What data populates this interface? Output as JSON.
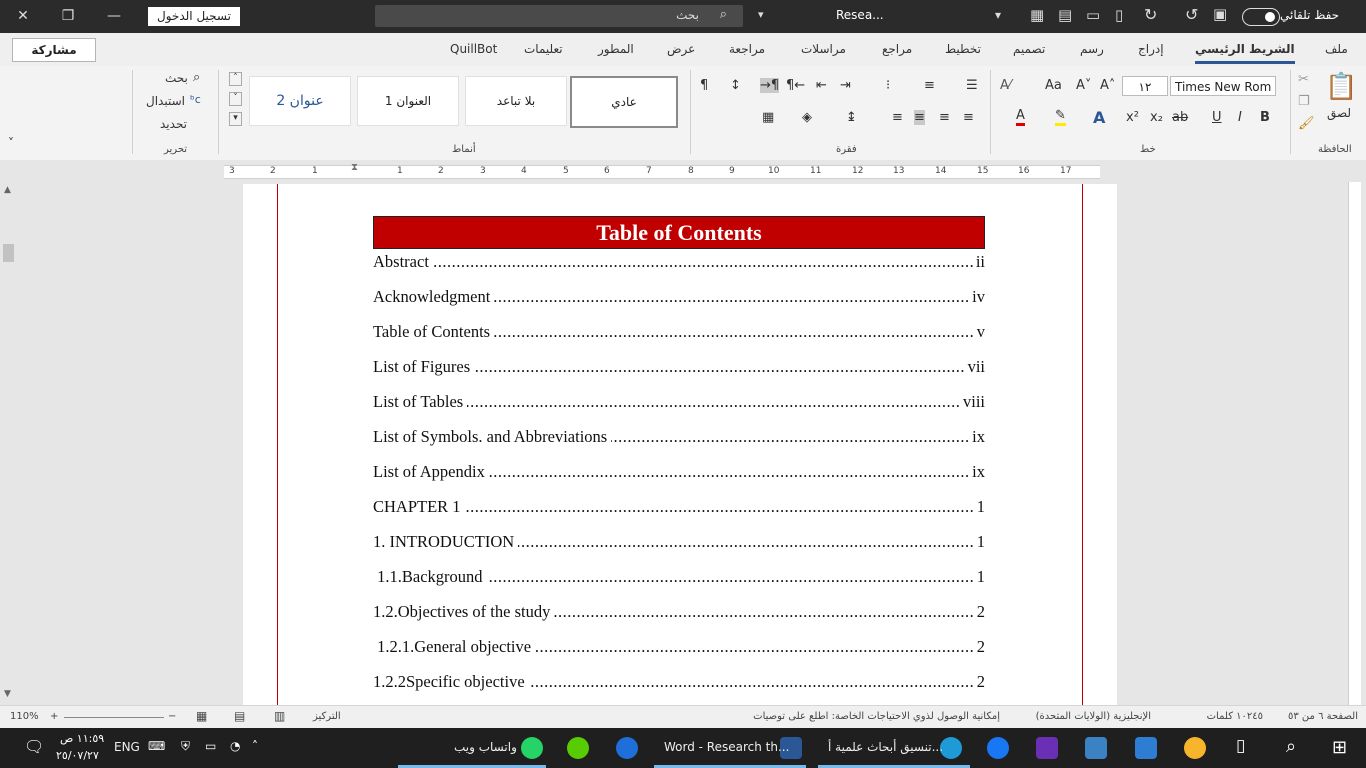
{
  "titlebar": {
    "sign_in": "تسجيل الدخول",
    "search_placeholder": "بحث",
    "doc_title": "Resea...",
    "autosave_label": "حفظ تلقائي",
    "close_glyph": "✕",
    "restore_glyph": "❐",
    "minimize_glyph": "—"
  },
  "tabs": [
    "ملف",
    "الشريط الرئيسي",
    "إدراج",
    "رسم",
    "تصميم",
    "تخطيط",
    "مراجع",
    "مراسلات",
    "مراجعة",
    "عرض",
    "المطور",
    "تعليمات",
    "QuillBot"
  ],
  "share_label": "مشاركة",
  "ribbon": {
    "clipboard_label": "الحافظة",
    "paste_label": "لصق",
    "font_label": "خط",
    "font_name": "Times New Rom",
    "font_size": "١٢",
    "paragraph_label": "فقرة",
    "styles_label": "أنماط",
    "styles": [
      "عادي",
      "بلا تباعد",
      "العنوان 1",
      "عنوان 2"
    ],
    "editing_label": "تحرير",
    "editing_items": [
      "بحث",
      "استبدال",
      "تحديد"
    ],
    "buttons": {
      "bold": "B",
      "italic": "I",
      "underline": "U",
      "strike": "ab",
      "subscript": "x₂",
      "superscript": "x²",
      "font_color": "A",
      "grow": "A^",
      "shrink": "A˅",
      "case": "Aa",
      "clear": "A⁄",
      "pilcrow": "¶"
    }
  },
  "ruler_numbers": [
    "3",
    "2",
    "1",
    "1",
    "2",
    "3",
    "4",
    "5",
    "6",
    "7",
    "8",
    "9",
    "10",
    "11",
    "12",
    "13",
    "14",
    "15",
    "16",
    "17"
  ],
  "document": {
    "toc_title": "Table of Contents",
    "toc": [
      {
        "text": "Abstract",
        "page": "ii"
      },
      {
        "text": "Acknowledgment",
        "page": "iv"
      },
      {
        "text": "Table of Contents",
        "page": "v"
      },
      {
        "text": "List of Figures",
        "page": "vii"
      },
      {
        "text": "List of Tables",
        "page": "viii"
      },
      {
        "text": "List of Symbols. and Abbreviations",
        "page": "ix"
      },
      {
        "text": "List of Appendix",
        "page": "ix"
      },
      {
        "text": "CHAPTER 1",
        "page": "1"
      },
      {
        "text": "1. INTRODUCTION",
        "page": "1"
      },
      {
        "text": " 1.1.Background",
        "page": "1"
      },
      {
        "text": "1.2.Objectives of the study",
        "page": "2"
      },
      {
        "text": " 1.2.1.General objective",
        "page": "2"
      },
      {
        "text": "1.2.2Specific objective",
        "page": "2"
      }
    ]
  },
  "statusbar": {
    "page": "الصفحة ٦ من ٥٣",
    "words": "١٠٢٤٥ كلمات",
    "language": "الإنجليزية (الولايات المتحدة)",
    "accessibility": "إمكانية الوصول لذوي الاحتياجات الخاصة: اطلع على توصيات",
    "focus": "التركيز",
    "zoom": "110%"
  },
  "taskbar": {
    "time": "١١:٥٩ ص",
    "date": "٢٥/٠٧/٢٧",
    "lang": "ENG",
    "apps": [
      "واتساب ويب",
      "Word - Research th...",
      "تنسيق أبحاث علمية أ..."
    ]
  },
  "colors": {
    "accent": "#2b5797",
    "toc_banner": "#c00000",
    "margin_line": "#c00000"
  }
}
